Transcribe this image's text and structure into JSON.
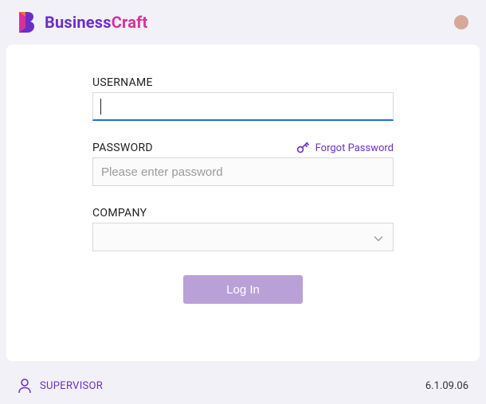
{
  "brand": {
    "name_part1": "Business",
    "name_part2": "Craft"
  },
  "form": {
    "username": {
      "label": "USERNAME",
      "value": ""
    },
    "password": {
      "label": "PASSWORD",
      "placeholder": "Please enter password",
      "forgot_label": "Forgot Password"
    },
    "company": {
      "label": "COMPANY"
    },
    "login_button": "Log In"
  },
  "footer": {
    "user_label": "SUPERVISOR",
    "version": "6.1.09.06"
  }
}
